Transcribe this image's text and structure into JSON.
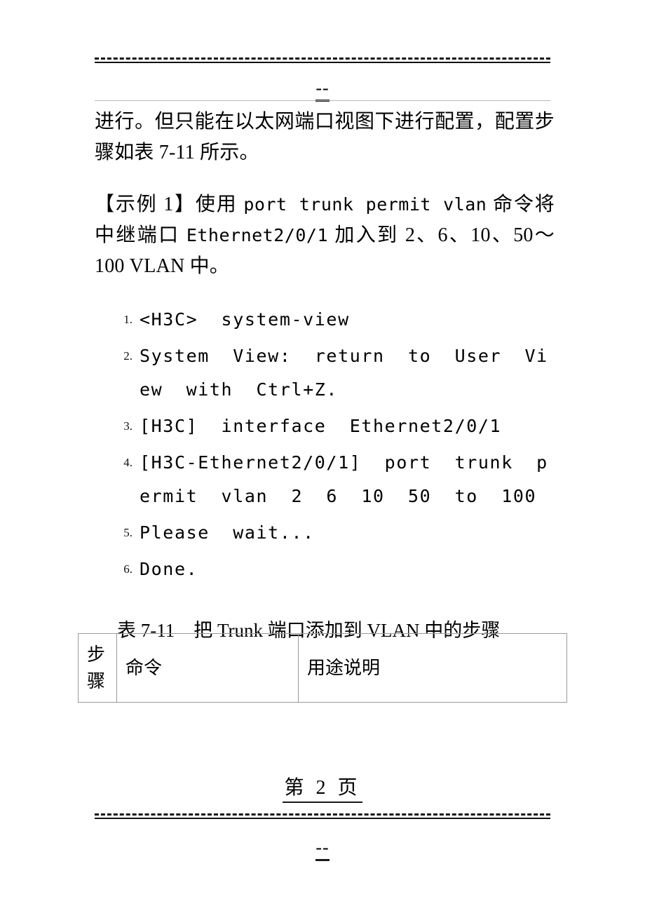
{
  "document": {
    "header": {
      "separator_mark": "--",
      "rule_style": "dashed-over-solid"
    },
    "body": {
      "paragraph_1": "进行。但只能在以太网端口视图下进行配置，配置步骤如表 7-11 所示。",
      "paragraph_2_prefix": "【示例 1】使用 ",
      "paragraph_2_command": "port trunk permit vlan",
      "paragraph_2_middle": " 命令将中继端口 ",
      "paragraph_2_interface": "Ethernet2/0/1",
      "paragraph_2_suffix": " 加入到 2、6、10、50～100 VLAN 中。",
      "code_list": [
        {
          "number": "1.",
          "text": "<H3C>  system-view"
        },
        {
          "number": "2.",
          "text": "System  View:  return  to  User  View  with  Ctrl+Z."
        },
        {
          "number": "3.",
          "text": "[H3C]  interface  Ethernet2/0/1"
        },
        {
          "number": "4.",
          "text": "[H3C-Ethernet2/0/1]  port  trunk  permit  vlan  2  6  10  50  to  100"
        },
        {
          "number": "5.",
          "text": "Please  wait..."
        },
        {
          "number": "6.",
          "text": "Done."
        }
      ],
      "table_caption": "表 7-11    把 Trunk 端口添加到 VLAN 中的步骤",
      "table": {
        "columns": [
          "步骤",
          "命令",
          "用途说明"
        ],
        "rows": []
      }
    },
    "footer": {
      "page_label": "第 2 页",
      "separator_mark": "--",
      "rule_style": "dashed-over-solid"
    }
  }
}
